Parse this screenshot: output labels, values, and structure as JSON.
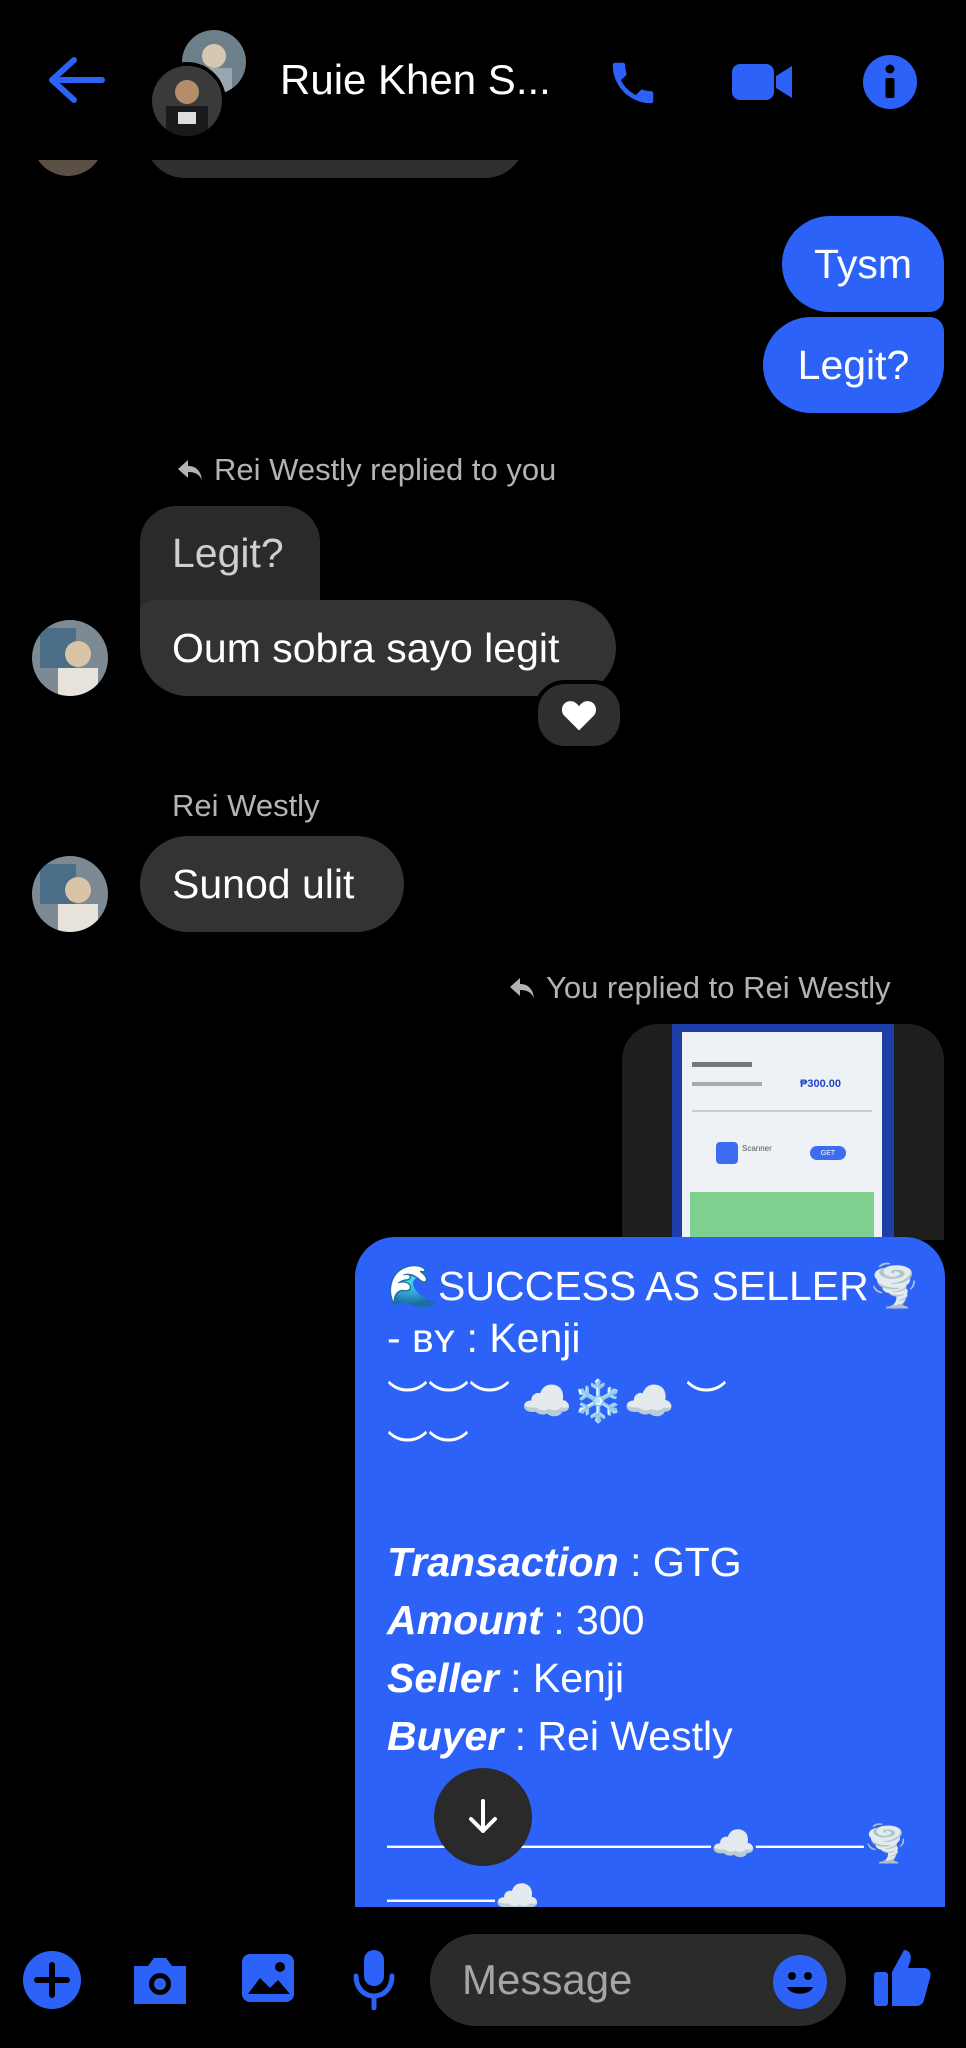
{
  "header": {
    "contact_name": "Ruie Khen S...",
    "back_icon": "arrow-left-icon",
    "call_icon": "phone-icon",
    "video_icon": "video-camera-icon",
    "info_icon": "info-icon",
    "accent_color": "#2d62f8"
  },
  "messages": {
    "tysm": "Tysm",
    "legit_sent": "Legit?",
    "reply_label_1": "Rei Westly replied to you",
    "quoted_legit": "Legit?",
    "oum": "Oum sobra sayo legit",
    "reaction": "heart",
    "sender_name": "Rei Westly",
    "sunod": "Sunod ulit",
    "reply_label_2": "You replied to Rei Westly"
  },
  "screenshot_thumb": {
    "amount": "₱300.00",
    "scanner_label": "Scanner",
    "get_label": "GET"
  },
  "card": {
    "title": "🌊SUCCESS AS SELLER🌪️",
    "by_prefix": "- ʙʏ :",
    "by_name": "Kenji",
    "deco_line_1": "︶︶︶ ☁️❄️☁️ ︶",
    "deco_line_2": "︶︶",
    "transaction_label": "Transaction",
    "transaction_value": ": GTG",
    "amount_label": "Amount",
    "amount_value": ": 300",
    "seller_label": "Seller",
    "seller_value": ": Kenji",
    "buyer_label": "Buyer",
    "buyer_value": ": Rei Westly",
    "deco_line_3": "—————————☁️———🌪️",
    "deco_line_4": "———☁️"
  },
  "composer": {
    "placeholder": "Message",
    "plus_icon": "plus-circle-icon",
    "camera_icon": "camera-icon",
    "gallery_icon": "image-icon",
    "mic_icon": "microphone-icon",
    "emoji_icon": "emoji-icon",
    "like_icon": "thumbs-up-icon"
  },
  "scroll_down_icon": "arrow-down-icon"
}
